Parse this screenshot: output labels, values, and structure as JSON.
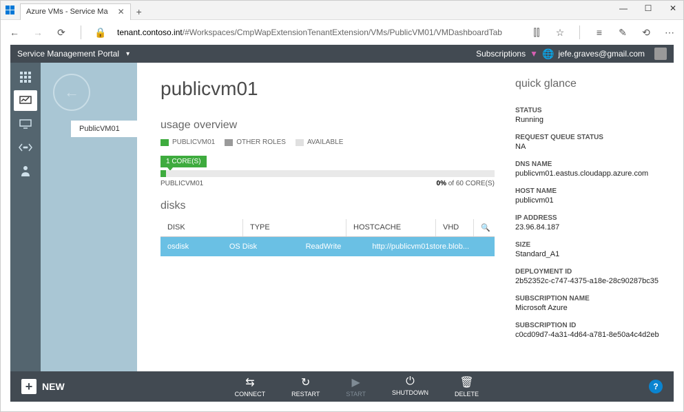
{
  "browser": {
    "tab_title": "Azure VMs - Service Ma",
    "url_host": "tenant.contoso.int",
    "url_path": "/#Workspaces/CmpWapExtensionTenantExtension/VMs/PublicVM01/VMDashboardTab"
  },
  "portal": {
    "title": "Service Management Portal",
    "subscriptions_label": "Subscriptions",
    "user_email": "jefe.graves@gmail.com"
  },
  "nav": {
    "selected": "PublicVM01"
  },
  "page": {
    "title": "publicvm01",
    "usage_title": "usage overview",
    "legend": [
      {
        "label": "PUBLICVM01",
        "color": "#3eab3e"
      },
      {
        "label": "OTHER ROLES",
        "color": "#9a9a9a"
      },
      {
        "label": "AVAILABLE",
        "color": "#e0e0e0"
      }
    ],
    "core_badge": "1 CORE(S)",
    "bar_label_left": "PUBLICVM01",
    "bar_pct": "0%",
    "bar_total": " of 60 CORE(S)"
  },
  "disks": {
    "title": "disks",
    "cols": [
      "DISK",
      "TYPE",
      "HOSTCACHE",
      "VHD"
    ],
    "rows": [
      {
        "disk": "osdisk",
        "type": "OS Disk",
        "hostcache": "ReadWrite",
        "vhd": "http://publicvm01store.blob..."
      }
    ]
  },
  "glance": {
    "title": "quick glance",
    "items": [
      {
        "label": "STATUS",
        "value": "Running"
      },
      {
        "label": "REQUEST QUEUE STATUS",
        "value": "NA"
      },
      {
        "label": "DNS NAME",
        "value": "publicvm01.eastus.cloudapp.azure.com"
      },
      {
        "label": "HOST NAME",
        "value": "publicvm01"
      },
      {
        "label": "IP ADDRESS",
        "value": "23.96.84.187"
      },
      {
        "label": "SIZE",
        "value": "Standard_A1"
      },
      {
        "label": "DEPLOYMENT ID",
        "value": "2b52352c-c747-4375-a18e-28c90287bc35"
      },
      {
        "label": "SUBSCRIPTION NAME",
        "value": "Microsoft Azure"
      },
      {
        "label": "SUBSCRIPTION ID",
        "value": "c0cd09d7-4a31-4d64-a781-8e50a4c4d2eb"
      }
    ]
  },
  "bottom": {
    "new": "NEW",
    "actions": [
      {
        "label": "CONNECT",
        "glyph": "⇆",
        "enabled": true
      },
      {
        "label": "RESTART",
        "glyph": "↻",
        "enabled": true
      },
      {
        "label": "START",
        "glyph": "▶",
        "enabled": false
      },
      {
        "label": "SHUTDOWN",
        "glyph": "⏻",
        "enabled": true
      },
      {
        "label": "DELETE",
        "glyph": "🗑",
        "enabled": true
      }
    ]
  }
}
